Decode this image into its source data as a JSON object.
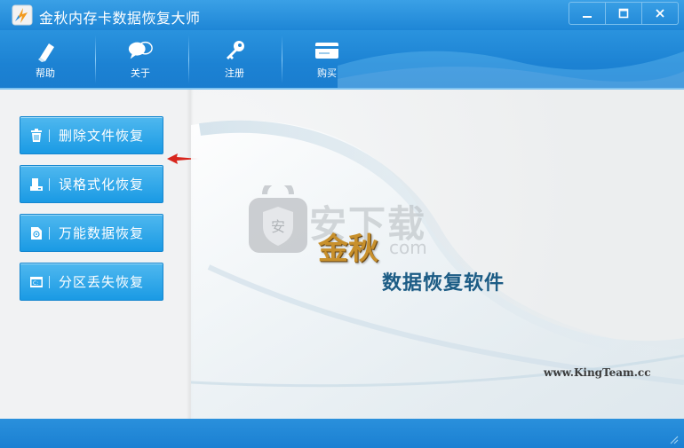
{
  "window": {
    "title": "金秋内存卡数据恢复大师"
  },
  "toolbar": {
    "items": [
      {
        "label": "帮助",
        "icon": "help-icon"
      },
      {
        "label": "关于",
        "icon": "about-icon"
      },
      {
        "label": "注册",
        "icon": "key-icon"
      },
      {
        "label": "购买",
        "icon": "card-icon"
      }
    ]
  },
  "menu": {
    "items": [
      {
        "label": "删除文件恢复",
        "icon": "trash-icon"
      },
      {
        "label": "误格式化恢复",
        "icon": "format-icon"
      },
      {
        "label": "万能数据恢复",
        "icon": "document-icon"
      },
      {
        "label": "分区丢失恢复",
        "icon": "partition-icon"
      }
    ]
  },
  "splash": {
    "brand": "金秋",
    "product": "数据恢复软件",
    "website": "www.KingTeam.cc",
    "watermark": "安下载",
    "watermark_sub": "com"
  },
  "colors": {
    "accent": "#1e86d6",
    "button": "#2aa4ea",
    "brand": "#c8902c",
    "product": "#1c5c85"
  }
}
